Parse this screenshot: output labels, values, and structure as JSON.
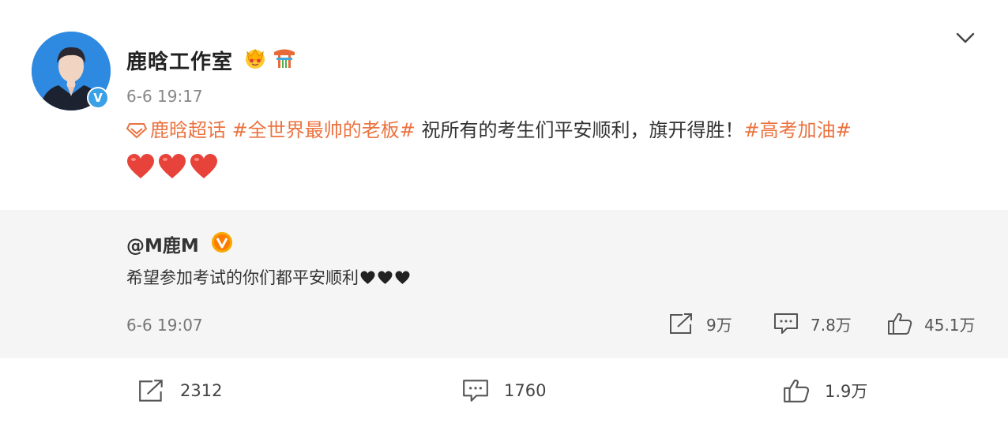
{
  "post": {
    "author": "鹿晗工作室",
    "time": "6-6 19:17",
    "super_topic": "鹿晗超话",
    "topic1": "#全世界最帅的老板#",
    "text": " 祝所有的考生们平安顺利，旗开得胜！",
    "topic2": "#高考加油#",
    "hearts_count": 3,
    "colors": {
      "topic": "#eb7340",
      "heart": "#e8433a",
      "verified": "#3aa1e6"
    },
    "icons": [
      "crown-badge-icon",
      "gate-badge-icon",
      "chevron-down-icon",
      "super-topic-icon",
      "verified-icon"
    ]
  },
  "repost": {
    "user": "@M鹿M",
    "text": "希望参加考试的你们都平安顺利",
    "time": "6-6 19:07",
    "forward_count": "9万",
    "comment_count": "7.8万",
    "like_count": "45.1万"
  },
  "footer": {
    "forward_count": "2312",
    "comment_count": "1760",
    "like_count": "1.9万"
  }
}
